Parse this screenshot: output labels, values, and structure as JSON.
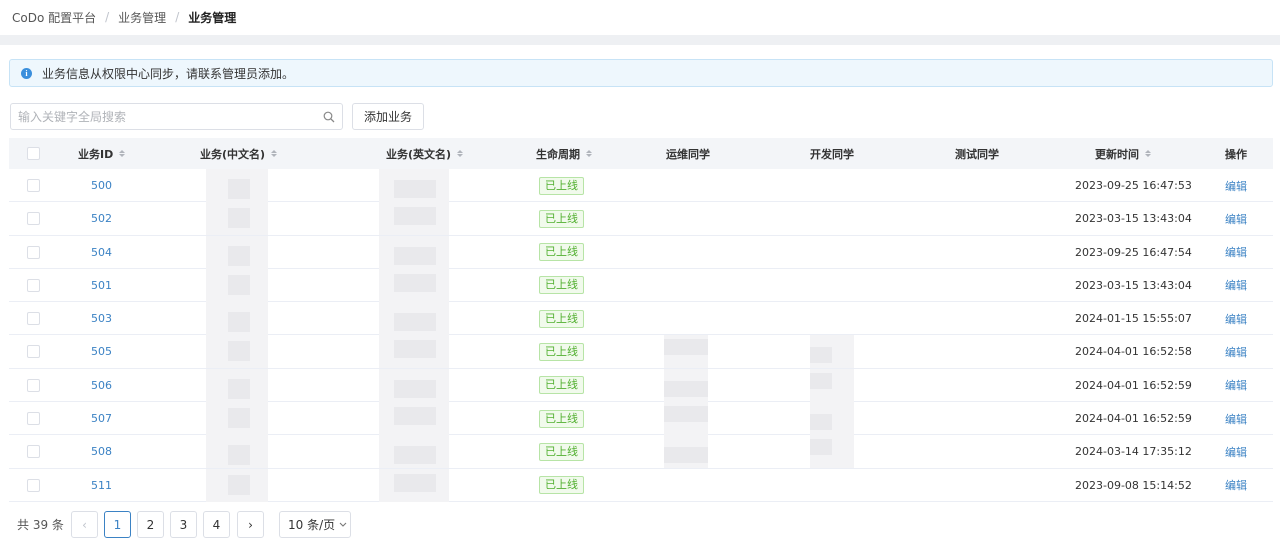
{
  "breadcrumb": {
    "items": [
      "CoDo 配置平台",
      "业务管理"
    ],
    "current": "业务管理"
  },
  "alert": {
    "text": "业务信息从权限中心同步，请联系管理员添加。"
  },
  "search": {
    "placeholder": "输入关键字全局搜索"
  },
  "toolbar": {
    "add_label": "添加业务"
  },
  "table": {
    "columns": [
      "业务ID",
      "业务(中文名)",
      "业务(英文名)",
      "生命周期",
      "运维同学",
      "开发同学",
      "测试同学",
      "更新时间",
      "操作"
    ],
    "rows": [
      {
        "id": "500",
        "status": "已上线",
        "updated": "2023-09-25 16:47:53",
        "action": "编辑"
      },
      {
        "id": "502",
        "status": "已上线",
        "updated": "2023-03-15 13:43:04",
        "action": "编辑"
      },
      {
        "id": "504",
        "status": "已上线",
        "updated": "2023-09-25 16:47:54",
        "action": "编辑"
      },
      {
        "id": "501",
        "status": "已上线",
        "updated": "2023-03-15 13:43:04",
        "action": "编辑"
      },
      {
        "id": "503",
        "status": "已上线",
        "updated": "2024-01-15 15:55:07",
        "action": "编辑"
      },
      {
        "id": "505",
        "status": "已上线",
        "updated": "2024-04-01 16:52:58",
        "action": "编辑"
      },
      {
        "id": "506",
        "status": "已上线",
        "updated": "2024-04-01 16:52:59",
        "action": "编辑"
      },
      {
        "id": "507",
        "status": "已上线",
        "updated": "2024-04-01 16:52:59",
        "action": "编辑"
      },
      {
        "id": "508",
        "status": "已上线",
        "updated": "2024-03-14 17:35:12",
        "action": "编辑"
      },
      {
        "id": "511",
        "status": "已上线",
        "updated": "2023-09-08 15:14:52",
        "action": "编辑"
      }
    ]
  },
  "pagination": {
    "total_text": "共 39 条",
    "prev": "‹",
    "next": "›",
    "pages": [
      "1",
      "2",
      "3",
      "4"
    ],
    "current": "1",
    "page_size": "10 条/页"
  },
  "colors": {
    "accent": "#3b82c4",
    "tag_green": "#52b030",
    "alert_bg": "#eef7fd"
  }
}
